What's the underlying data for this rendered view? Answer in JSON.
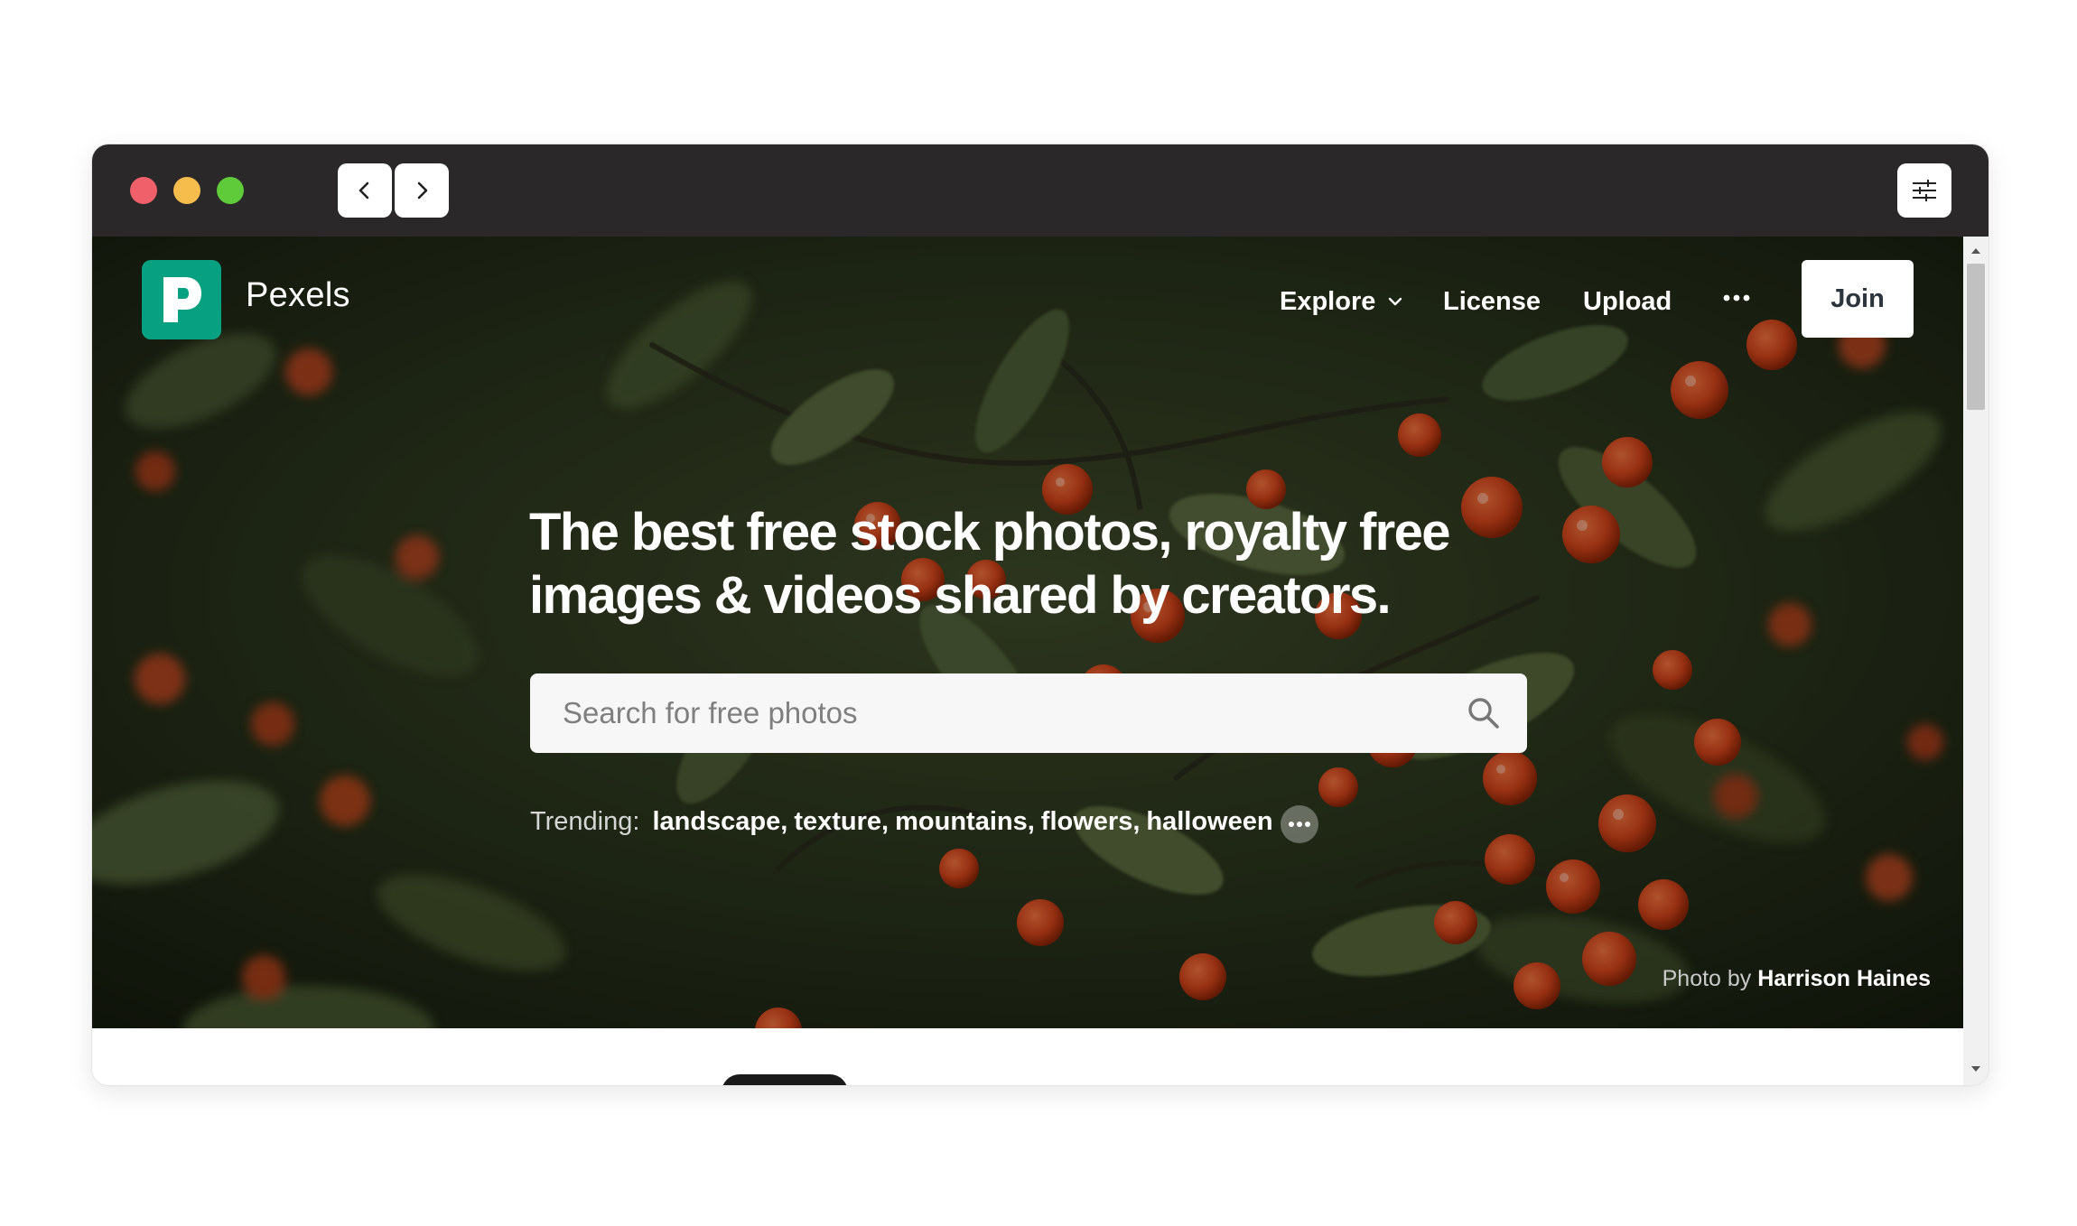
{
  "window": {
    "traffic_lights": [
      "close",
      "minimize",
      "maximize"
    ],
    "nav": {
      "back_icon": "chevron-left-icon",
      "forward_icon": "chevron-right-icon"
    },
    "settings_icon": "sliders-icon"
  },
  "site": {
    "brand": {
      "name": "Pexels",
      "logo_letter_icon": "pexels-p-logo",
      "color": "#07a081"
    },
    "nav": {
      "explore": "Explore",
      "license": "License",
      "upload": "Upload",
      "more_icon": "ellipsis-icon",
      "join": "Join"
    },
    "hero": {
      "headline_line1": "The best free stock photos, royalty free",
      "headline_line2": "images & videos shared by creators.",
      "search_placeholder": "Search for free photos",
      "trending_label": "Trending:",
      "trending": [
        "landscape",
        "texture",
        "mountains",
        "flowers",
        "halloween"
      ],
      "credit_prefix": "Photo by",
      "credit_name": "Harrison Haines"
    }
  }
}
